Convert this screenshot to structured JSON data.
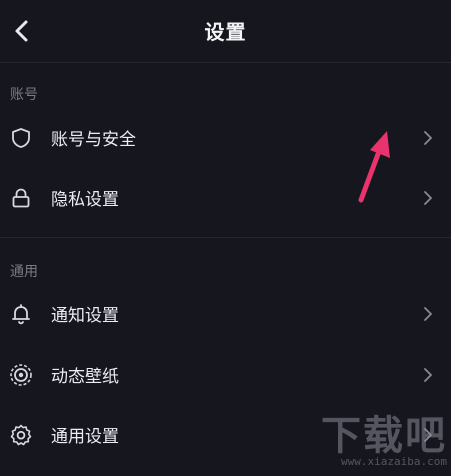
{
  "header": {
    "title": "设置"
  },
  "sections": [
    {
      "label": "账号",
      "items": [
        {
          "label": "账号与安全",
          "icon": "shield-icon"
        },
        {
          "label": "隐私设置",
          "icon": "lock-icon"
        }
      ]
    },
    {
      "label": "通用",
      "items": [
        {
          "label": "通知设置",
          "icon": "bell-icon"
        },
        {
          "label": "动态壁纸",
          "icon": "live-wallpaper-icon"
        },
        {
          "label": "通用设置",
          "icon": "gear-icon"
        }
      ]
    }
  ],
  "watermark": {
    "main": "下载吧",
    "sub": "www.xiazaiba.com"
  },
  "colors": {
    "background": "#16161f",
    "text": "#ececf2",
    "muted": "#7b7b86",
    "annotation": "#e8336e"
  }
}
